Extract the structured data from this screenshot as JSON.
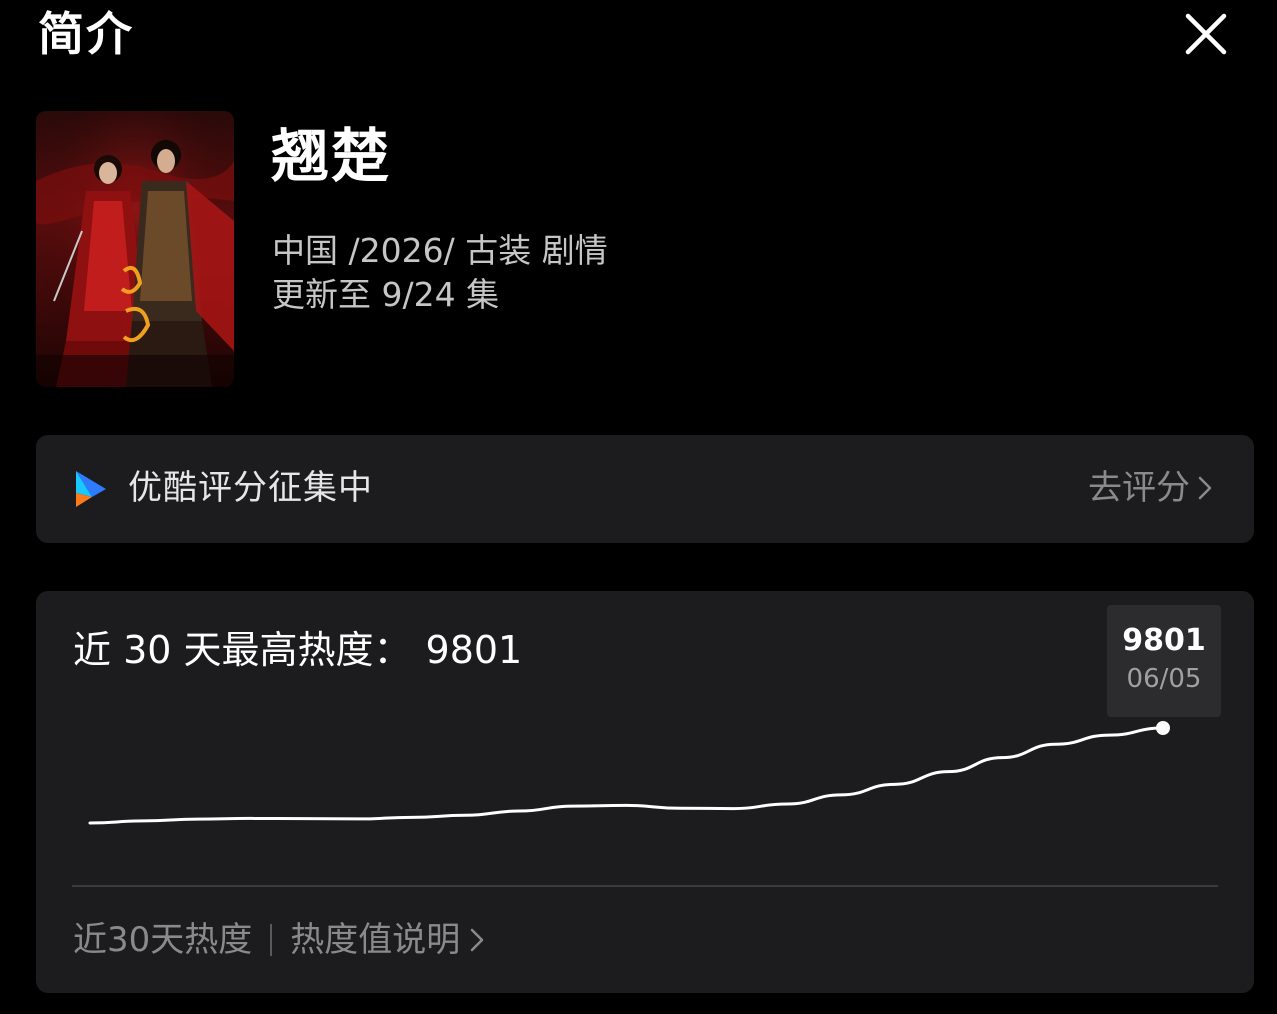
{
  "header": {
    "title": "简介"
  },
  "show": {
    "title": "翘楚",
    "meta_line1": "中国 /2026/ 古装 剧情",
    "meta_line2": "更新至 9/24 集",
    "poster_icon": "poster-image"
  },
  "rating": {
    "text": "优酷评分征集中",
    "action": "去评分",
    "logo_colors": [
      "#2d7bff",
      "#19c8ff",
      "#ff7a1a"
    ]
  },
  "heat": {
    "title": "近 30 天最高热度：",
    "peak_value": "9801",
    "tooltip_value": "9801",
    "tooltip_date": "06/05",
    "footer_label": "近30天热度",
    "footer_link": "热度值说明"
  },
  "chart_data": {
    "type": "line",
    "title": "",
    "xlabel": "",
    "ylabel": "",
    "grid": false,
    "ylim": [
      0,
      10000
    ],
    "series": [
      {
        "values": [
          8450,
          8480,
          8505,
          8515,
          8512,
          8508,
          8530,
          8560,
          8620,
          8690,
          8700,
          8660,
          8655,
          8720,
          8850,
          9000,
          9180,
          9380,
          9570,
          9700,
          9801
        ]
      }
    ],
    "highlight": {
      "index": 20,
      "value": 9801,
      "label": "06/05"
    }
  },
  "colors": {
    "background": "#000000",
    "card": "#1c1c1e",
    "line": "#ffffff",
    "muted": "#8a8a8a"
  }
}
